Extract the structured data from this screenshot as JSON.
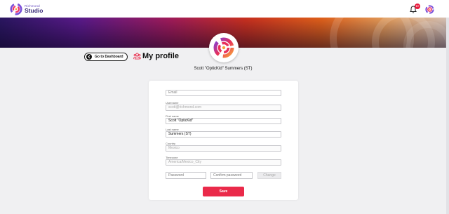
{
  "app": {
    "brand_small": "Richmond",
    "brand_big": "Studio",
    "notification_count": "9+"
  },
  "header": {
    "dashboard_button": "Go to Dashboard",
    "title": "My profile",
    "user_display_name": "Scott \"OpticKid\" Summers (ST)"
  },
  "form": {
    "email": {
      "label": "",
      "value": "",
      "placeholder": "Email"
    },
    "username": {
      "label": "Username",
      "value": "scott@richmond.com"
    },
    "first_name": {
      "label": "First name",
      "value": "Scott \"OpticKid\""
    },
    "last_name": {
      "label": "Last name",
      "value": "Summers (ST)"
    },
    "country": {
      "label": "Country",
      "value": "Mexico"
    },
    "timezone": {
      "label": "Timezone",
      "value": "America/Mexico_City"
    },
    "password": {
      "placeholder": "Password"
    },
    "confirm_password": {
      "placeholder": "Confirm password"
    },
    "change_button": "Change",
    "save_button": "Save"
  },
  "colors": {
    "accent": "#ea2a4a",
    "brand_purple": "#6a4fc0",
    "banner_start": "#2a1660",
    "banner_mid": "#c9301f",
    "banner_end": "#e39a58"
  },
  "icons": {
    "brand": "richmond-swirl-logo-icon",
    "notifications": "bell-icon",
    "user": "user-avatar-icon",
    "dashboard": "arrow-left-icon",
    "profile_title": "profile-group-icon"
  }
}
